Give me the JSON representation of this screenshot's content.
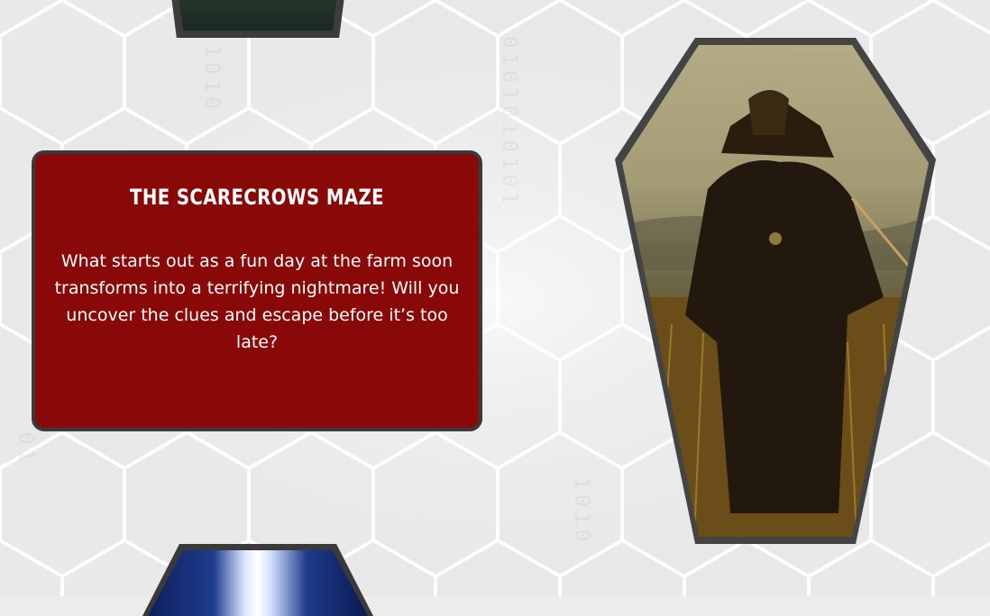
{
  "card": {
    "title": "THE SCARECROWS MAZE",
    "description": "What starts out as a fun day at the farm soon transforms into a terrifying nightmare! Will you uncover the clues and escape before it’s too late?"
  },
  "images": {
    "top_coffin": "coffin-framed-image",
    "scarecrow": "scarecrow-image",
    "bottom_coffin": "coffin-framed-image"
  },
  "colors": {
    "card_background": "#890908",
    "frame": "#3a3a3a",
    "page_background": "#ececec"
  }
}
